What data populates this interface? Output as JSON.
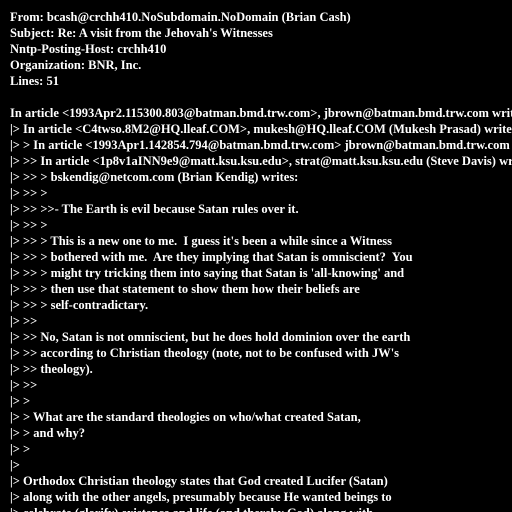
{
  "terminal": {
    "background": "#000000",
    "foreground": "#ffffff",
    "lines": [
      "From: bcash@crchh410.NoSubdomain.NoDomain (Brian Cash)",
      "Subject: Re: A visit from the Jehovah's Witnesses",
      "Nntp-Posting-Host: crchh410",
      "Organization: BNR, Inc.",
      "Lines: 51",
      "",
      "In article <1993Apr2.115300.803@batman.bmd.trw.com>, jbrown@batman.bmd.trw.com writes:",
      "|> In article <C4twso.8M2@HQ.lleaf.COM>, mukesh@HQ.lleaf.COM (Mukesh Prasad) writes:",
      "|> > In article <1993Apr1.142854.794@batman.bmd.trw.com> jbrown@batman.bmd.trw.com writes:",
      "|> >> In article <1p8v1aINN9e9@matt.ksu.ksu.edu>, strat@matt.ksu.ksu.edu (Steve Davis) writes:",
      "|> >> > bskendig@netcom.com (Brian Kendig) writes:",
      "|> >> >",
      "|> >> >>- The Earth is evil because Satan rules over it.",
      "|> >> >",
      "|> >> > This is a new one to me.  I guess it's been a while since a Witness",
      "|> >> > bothered with me.  Are they implying that Satan is omniscient?  You",
      "|> >> > might try tricking them into saying that Satan is 'all-knowing' and",
      "|> >> > then use that statement to show them how their beliefs are",
      "|> >> > self-contradictary.",
      "|> >>",
      "|> >> No, Satan is not omniscient, but he does hold dominion over the earth",
      "|> >> according to Christian theology (note, not to be confused with JW's",
      "|> >> theology).",
      "|> >>",
      "|> >",
      "|> > What are the standard theologies on who/what created Satan,",
      "|> > and why?",
      "|> >",
      "|>",
      "|> Orthodox Christian theology states that God created Lucifer (Satan)",
      "|> along with the other angels, presumably because He wanted beings to",
      "|> celebrate (glorify) existence and life (and thereby God) along with"
    ]
  }
}
